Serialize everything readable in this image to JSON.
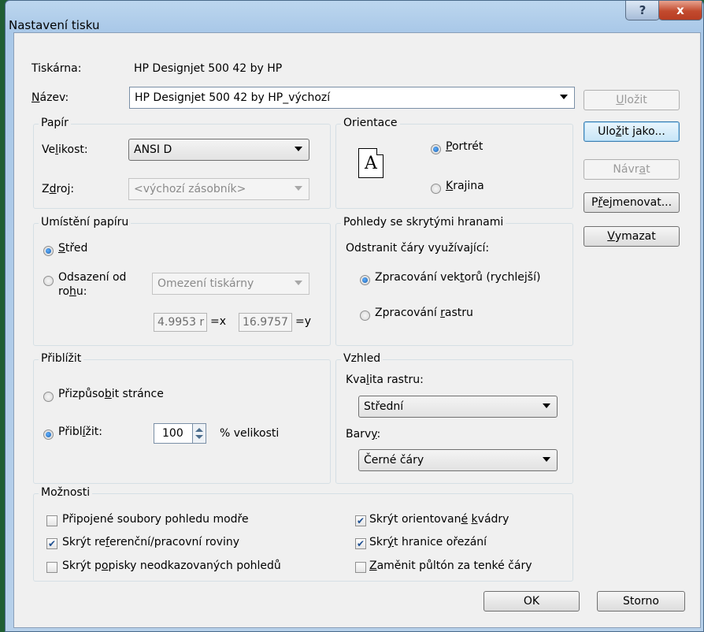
{
  "window": {
    "title": "Nastavení tisku",
    "help_label": "?",
    "close_label": "x"
  },
  "printer": {
    "label": "Tiskárna:",
    "value": "HP Designjet 500 42 by HP"
  },
  "name": {
    "label": "Název:",
    "value": "HP Designjet 500 42 by HP_výchozí"
  },
  "side_buttons": {
    "save": "Uložit",
    "save_as": "Uložit jako...",
    "revert": "Návrat",
    "rename": "Přejmenovat...",
    "delete": "Vymazat"
  },
  "paper": {
    "title": "Papír",
    "size_label": "Velikost:",
    "size_value": "ANSI D",
    "source_label": "Zdroj:",
    "source_value": "<výchozí zásobník>"
  },
  "orientation": {
    "title": "Orientace",
    "icon_letter": "A",
    "portrait": "Portrét",
    "landscape": "Krajina"
  },
  "placement": {
    "title": "Umístění papíru",
    "center": "Střed",
    "offset_line1": "Odsazení od",
    "offset_line2": "rohu:",
    "offset_combo": "Omezení tiskárny",
    "x_value": "4.9953 r",
    "x_suffix": "=x",
    "y_value": "16.9757",
    "y_suffix": "=y"
  },
  "hidden_lines": {
    "title": "Pohledy se skrytými hranami",
    "label": "Odstranit čáry využívající:",
    "vector": "Zpracování vektorů (rychlejší)",
    "raster": "Zpracování rastru"
  },
  "zoom": {
    "title": "Přiblížit",
    "fit": "Přizpůsobit stránce",
    "zoom_label": "Přiblížit:",
    "zoom_value": "100",
    "zoom_suffix": "% velikosti"
  },
  "appearance": {
    "title": "Vzhled",
    "quality_label": "Kvalita rastru:",
    "quality_value": "Střední",
    "colors_label": "Barvy:",
    "colors_value": "Černé čáry"
  },
  "options": {
    "title": "Možnosti",
    "linked_files": "Připojené soubory pohledu modře",
    "hide_ref_planes": "Skrýt referenční/pracovní roviny",
    "hide_unref_tags": "Skrýt popisky neodkazovaných pohledů",
    "hide_scope_boxes": "Skrýt orientované kvádry",
    "hide_crop_bounds": "Skrýt hranice ořezání",
    "halftone_thin": "Zaměnit půltón za tenké čáry"
  },
  "footer": {
    "ok": "OK",
    "cancel": "Storno"
  }
}
